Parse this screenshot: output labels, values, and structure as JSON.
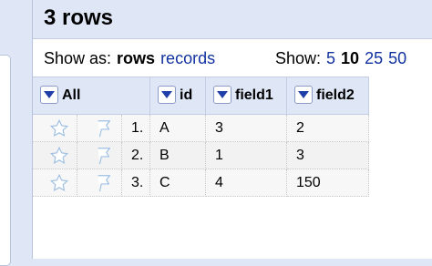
{
  "header": {
    "title": "3 rows"
  },
  "view": {
    "label": "Show as:",
    "selected": "rows",
    "alt": "records"
  },
  "pager": {
    "label": "Show:",
    "options": [
      "5",
      "10",
      "25",
      "50"
    ],
    "current": "10"
  },
  "columns": [
    "All",
    "id",
    "field1",
    "field2"
  ],
  "rows": [
    {
      "num": "1.",
      "id": "A",
      "field1": "3",
      "field2": "2"
    },
    {
      "num": "2.",
      "id": "B",
      "field1": "1",
      "field2": "3"
    },
    {
      "num": "3.",
      "id": "C",
      "field1": "4",
      "field2": "150"
    }
  ],
  "icons": {
    "star": "star-icon",
    "flag": "flag-icon",
    "dropdown": "dropdown-arrow-icon"
  },
  "colors": {
    "header_bg": "#dfe6f6",
    "link": "#11329f",
    "dropdown_arrow": "#1f3ea8"
  }
}
